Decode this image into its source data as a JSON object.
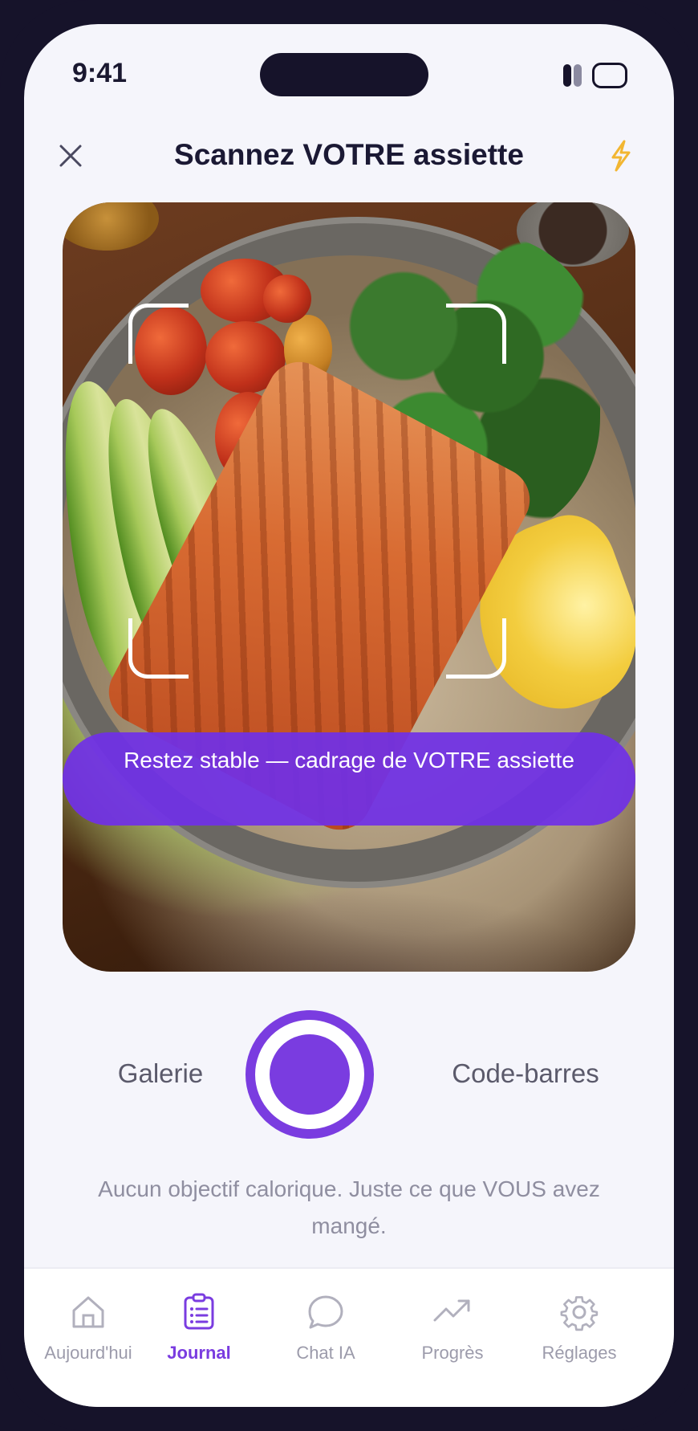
{
  "status_bar": {
    "time": "9:41"
  },
  "header": {
    "title": "Scannez VOTRE assiette"
  },
  "camera": {
    "banner": "Restez stable — cadrage de VOTRE assiette"
  },
  "controls": {
    "gallery_label": "Galerie",
    "barcode_label": "Code-barres"
  },
  "note": "Aucun objectif calorique. Juste ce que VOUS avez mangé.",
  "tabbar": {
    "items": [
      {
        "label": "Aujourd'hui",
        "icon": "home-icon"
      },
      {
        "label": "Journal",
        "icon": "clipboard-icon",
        "active": true
      },
      {
        "label": "Chat IA",
        "icon": "chat-bubble-icon"
      },
      {
        "label": "Progrès",
        "icon": "trend-up-icon"
      },
      {
        "label": "Réglages",
        "icon": "gear-icon"
      }
    ]
  },
  "colors": {
    "accent": "#7A3CE0",
    "flash": "#F2B632",
    "background": "#F5F5FB",
    "frame": "#16132A"
  }
}
